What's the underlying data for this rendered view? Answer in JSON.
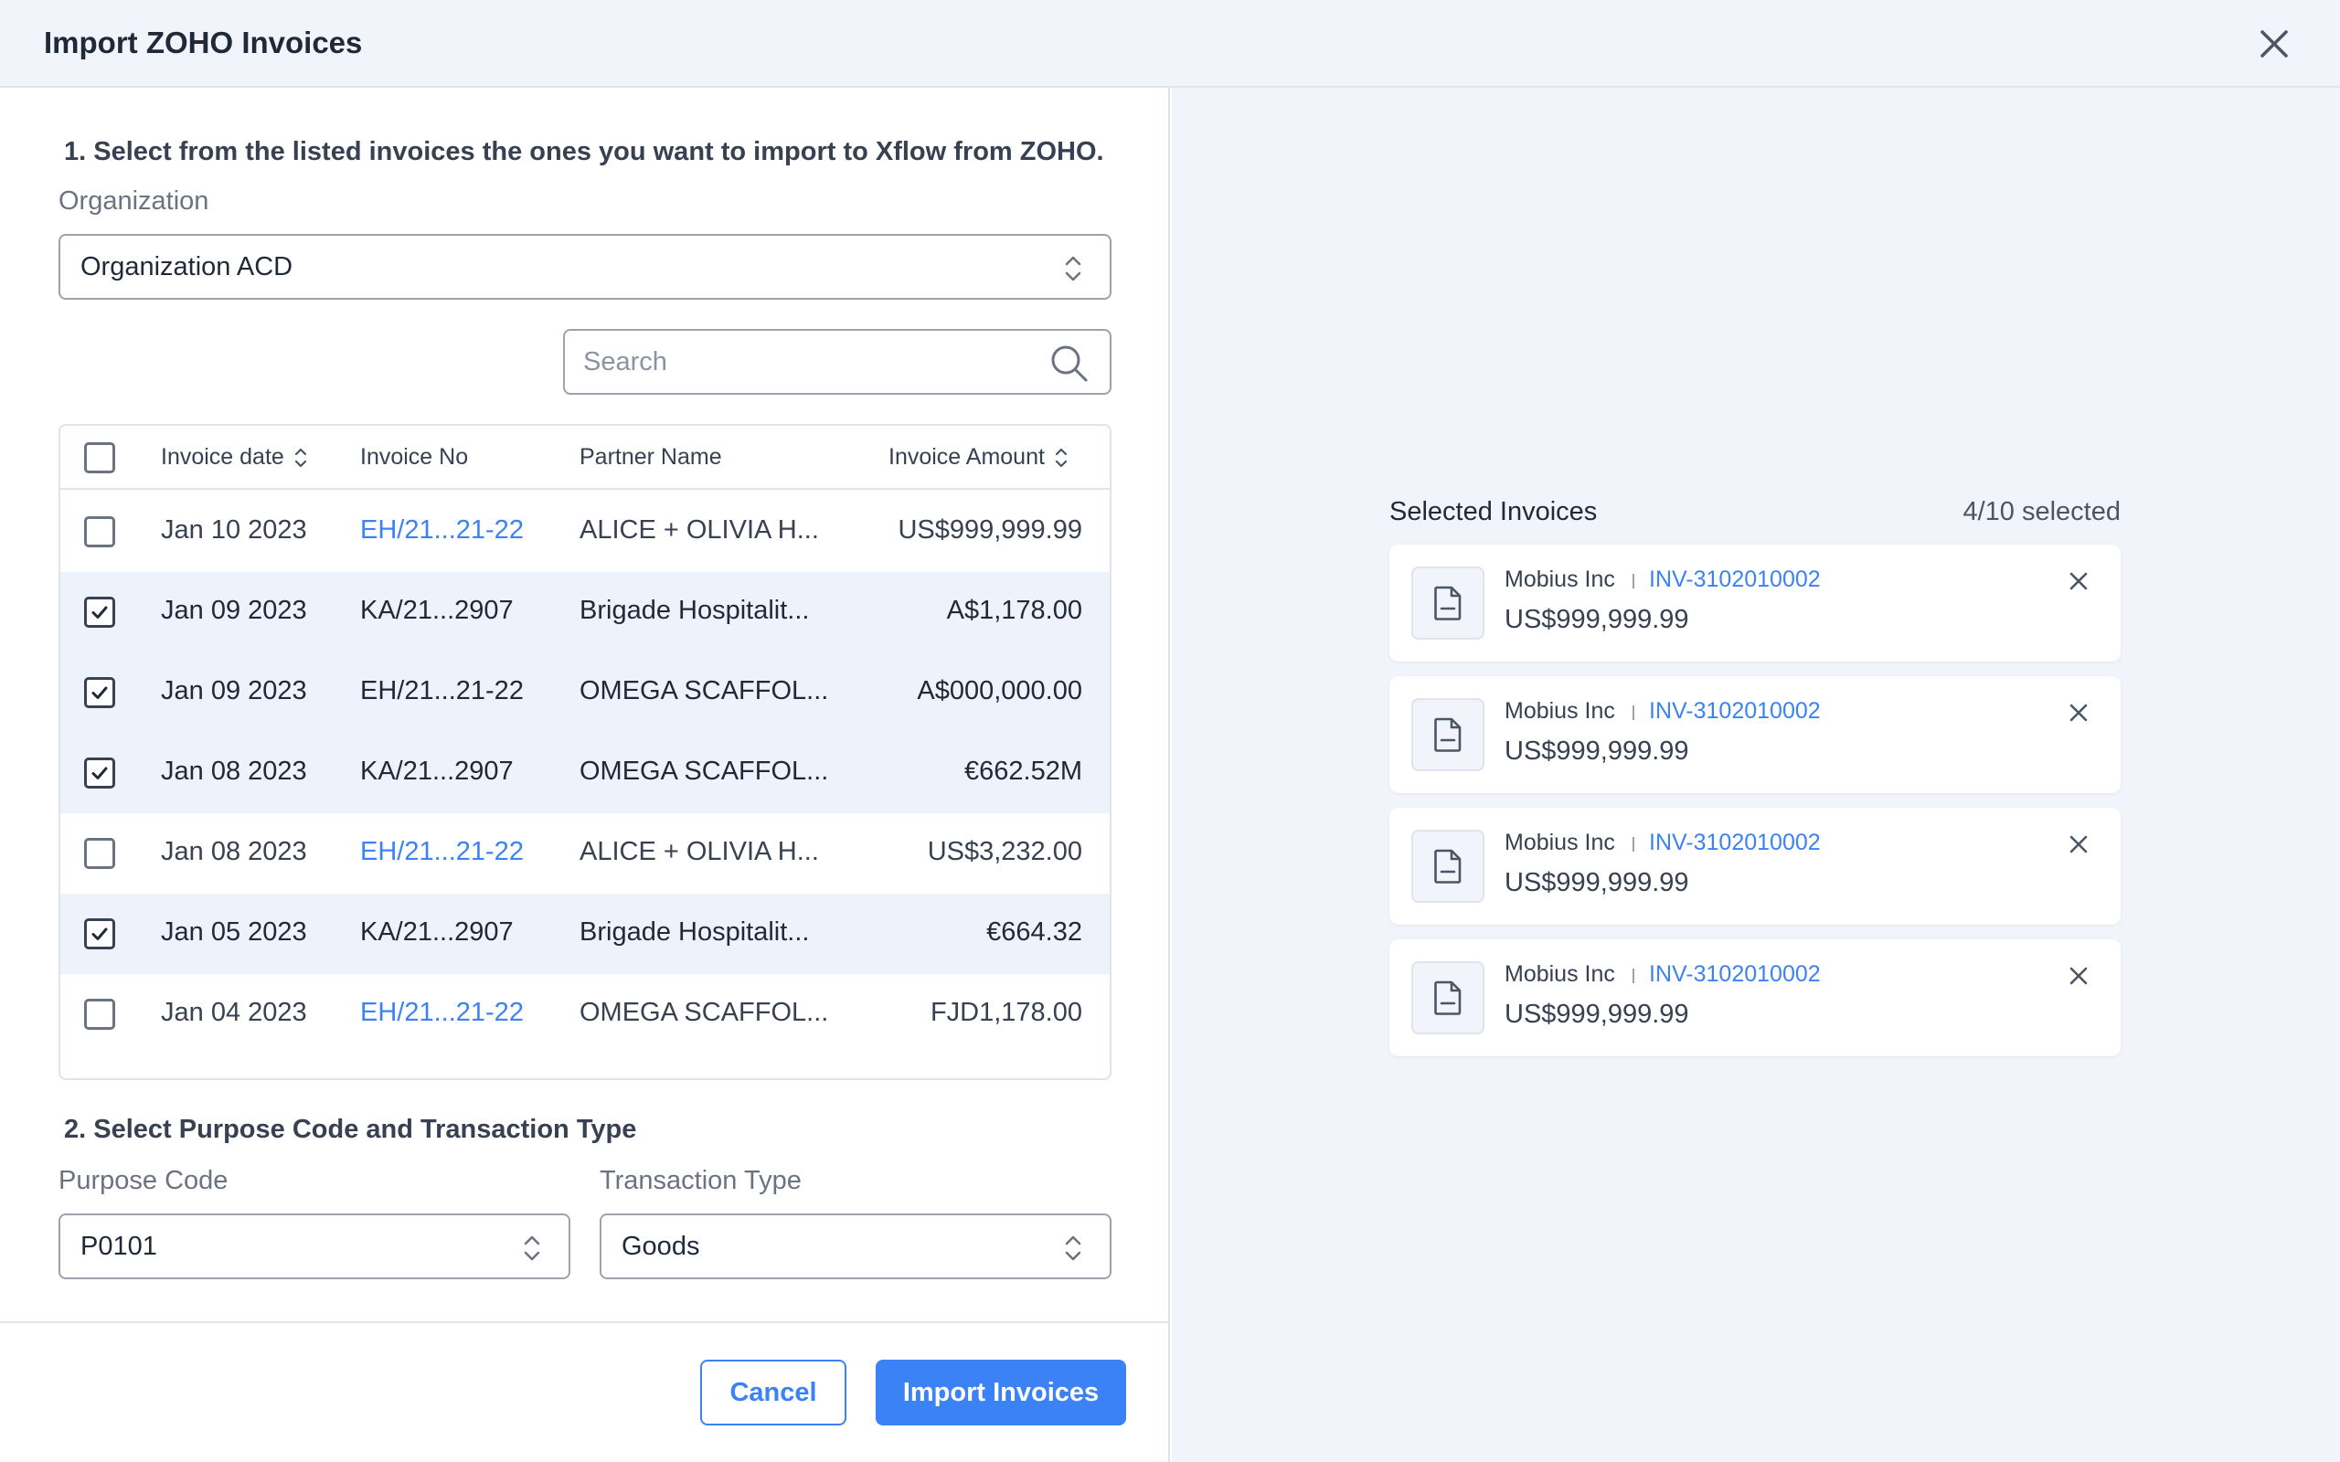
{
  "modal": {
    "title": "Import ZOHO Invoices"
  },
  "step1": {
    "title": "1. Select from the listed invoices the ones you want to import to Xflow from ZOHO.",
    "organization_label": "Organization",
    "organization_value": "Organization ACD",
    "search_placeholder": "Search"
  },
  "table": {
    "headers": {
      "date": "Invoice date",
      "number": "Invoice No",
      "partner": "Partner Name",
      "amount": "Invoice Amount"
    },
    "rows": [
      {
        "date": "Jan 10 2023",
        "number": "EH/21...21-22",
        "partner": "ALICE + OLIVIA H...",
        "amount": "US$999,999.99",
        "checked": false
      },
      {
        "date": "Jan 09 2023",
        "number": "KA/21...2907",
        "partner": "Brigade Hospitalit...",
        "amount": "A$1,178.00",
        "checked": true
      },
      {
        "date": "Jan 09 2023",
        "number": "EH/21...21-22",
        "partner": "OMEGA SCAFFOL...",
        "amount": "A$000,000.00",
        "checked": true
      },
      {
        "date": "Jan 08 2023",
        "number": "KA/21...2907",
        "partner": "OMEGA SCAFFOL...",
        "amount": "€662.52M",
        "checked": true
      },
      {
        "date": "Jan 08 2023",
        "number": "EH/21...21-22",
        "partner": "ALICE + OLIVIA H...",
        "amount": "US$3,232.00",
        "checked": false
      },
      {
        "date": "Jan 05 2023",
        "number": "KA/21...2907",
        "partner": "Brigade Hospitalit...",
        "amount": "€664.32",
        "checked": true
      },
      {
        "date": "Jan 04 2023",
        "number": "EH/21...21-22",
        "partner": "OMEGA SCAFFOL...",
        "amount": "FJD1,178.00",
        "checked": false
      }
    ]
  },
  "step2": {
    "title": "2. Select Purpose Code and Transaction Type",
    "purpose_label": "Purpose Code",
    "purpose_value": "P0101",
    "type_label": "Transaction Type",
    "type_value": "Goods"
  },
  "footer": {
    "cancel_label": "Cancel",
    "import_label": "Import Invoices"
  },
  "selected": {
    "title": "Selected Invoices",
    "count": "4/10 selected",
    "items": [
      {
        "partner": "Mobius Inc",
        "number": "INV-3102010002",
        "amount": "US$999,999.99"
      },
      {
        "partner": "Mobius Inc",
        "number": "INV-3102010002",
        "amount": "US$999,999.99"
      },
      {
        "partner": "Mobius Inc",
        "number": "INV-3102010002",
        "amount": "US$999,999.99"
      },
      {
        "partner": "Mobius Inc",
        "number": "INV-3102010002",
        "amount": "US$999,999.99"
      }
    ]
  },
  "colors": {
    "accent": "#3b82f6",
    "header_bg": "#f1f4fb",
    "selected_row_bg": "#eef2fb",
    "border": "#dfe3ea"
  },
  "icons": {
    "close": "close-icon",
    "search": "search-icon",
    "sort": "sort-icon",
    "select_toggle": "chevron-up-down-icon",
    "checkbox_checked": "checkmark-icon",
    "invoice": "document-icon",
    "remove": "close-icon"
  }
}
